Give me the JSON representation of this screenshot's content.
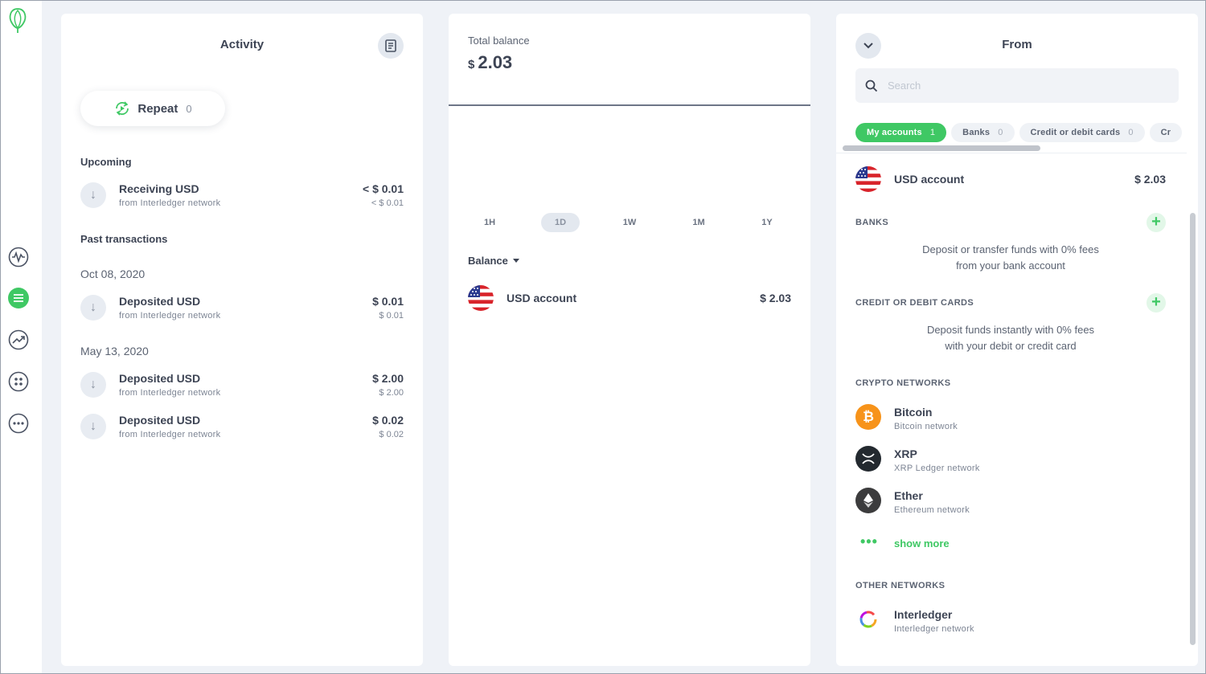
{
  "sidebar": {
    "items": [
      {
        "icon": "activity-pulse-icon"
      },
      {
        "icon": "list-icon",
        "active": true
      },
      {
        "icon": "trending-icon"
      },
      {
        "icon": "apps-icon"
      },
      {
        "icon": "more-icon"
      }
    ]
  },
  "activity": {
    "title": "Activity",
    "repeat_label": "Repeat",
    "repeat_count": "0",
    "upcoming_heading": "Upcoming",
    "upcoming": [
      {
        "title": "Receiving USD",
        "subtitle": "from Interledger network",
        "amount": "< $ 0.01",
        "amount_sub": "< $ 0.01"
      }
    ],
    "past_heading": "Past transactions",
    "groups": [
      {
        "date": "Oct 08, 2020",
        "items": [
          {
            "title": "Deposited USD",
            "subtitle": "from Interledger network",
            "amount": "$ 0.01",
            "amount_sub": "$ 0.01"
          }
        ]
      },
      {
        "date": "May 13, 2020",
        "items": [
          {
            "title": "Deposited USD",
            "subtitle": "from Interledger network",
            "amount": "$ 2.00",
            "amount_sub": "$ 2.00"
          },
          {
            "title": "Deposited USD",
            "subtitle": "from Interledger network",
            "amount": "$ 0.02",
            "amount_sub": "$ 0.02"
          }
        ]
      }
    ]
  },
  "balance": {
    "label": "Total balance",
    "currency": "$",
    "value": "2.03",
    "ranges": [
      "1H",
      "1D",
      "1W",
      "1M",
      "1Y"
    ],
    "active_range": "1D",
    "dropdown_label": "Balance",
    "account": {
      "name": "USD account",
      "amount": "$ 2.03"
    }
  },
  "from": {
    "title": "From",
    "search_placeholder": "Search",
    "chips": [
      {
        "label": "My accounts",
        "count": "1"
      },
      {
        "label": "Banks",
        "count": "0"
      },
      {
        "label": "Credit or debit cards",
        "count": "0"
      },
      {
        "label": "Cr",
        "count": ""
      }
    ],
    "account": {
      "name": "USD account",
      "amount": "$ 2.03"
    },
    "banks_heading": "BANKS",
    "banks_desc_1": "Deposit or transfer funds with 0% fees",
    "banks_desc_2": "from your bank account",
    "cards_heading": "CREDIT OR DEBIT CARDS",
    "cards_desc_1": "Deposit funds instantly with 0% fees",
    "cards_desc_2": "with your debit or credit card",
    "crypto_heading": "CRYPTO NETWORKS",
    "crypto": [
      {
        "name": "Bitcoin",
        "sub": "Bitcoin network",
        "icon": "bitcoin-icon"
      },
      {
        "name": "XRP",
        "sub": "XRP Ledger network",
        "icon": "xrp-icon"
      },
      {
        "name": "Ether",
        "sub": "Ethereum network",
        "icon": "ether-icon"
      }
    ],
    "show_more": "show more",
    "other_heading": "OTHER NETWORKS",
    "other": [
      {
        "name": "Interledger",
        "sub": "Interledger network",
        "icon": "interledger-icon"
      }
    ]
  },
  "colors": {
    "accent": "#3fc864",
    "background": "#eff2f7",
    "text": "#3d4454"
  }
}
